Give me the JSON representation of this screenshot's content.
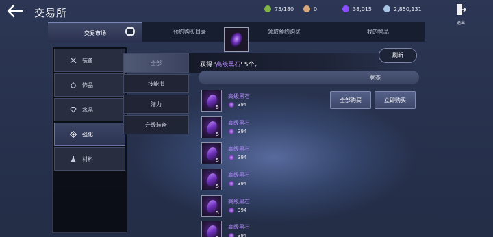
{
  "header": {
    "title": "交易所",
    "resources": [
      {
        "value": "75/180",
        "color": "#7fb344",
        "icon": "bag-icon"
      },
      {
        "value": "0",
        "color": "#d9a87a",
        "icon": "coin-icon"
      },
      {
        "value": "38,015",
        "color": "#8a4cff",
        "icon": "black-stone-currency-icon"
      },
      {
        "value": "2,850,131",
        "color": "#aac4e6",
        "icon": "silver-icon"
      }
    ],
    "exit_label": "退出"
  },
  "tabs": [
    {
      "label": "交易市场",
      "active": true
    },
    {
      "label": "预约购买目录",
      "active": false
    },
    {
      "label": "领取预约购买",
      "active": false
    },
    {
      "label": "我的物品",
      "active": false
    }
  ],
  "categories": [
    {
      "label": "装备",
      "icon": "crossed-swords-icon"
    },
    {
      "label": "饰品",
      "icon": "ring-icon"
    },
    {
      "label": "水晶",
      "icon": "crystal-icon"
    },
    {
      "label": "强化",
      "icon": "enhance-icon",
      "active": true
    },
    {
      "label": "材料",
      "icon": "flask-icon"
    }
  ],
  "subcategories": [
    {
      "label": "全部",
      "active": true
    },
    {
      "label": "技能书"
    },
    {
      "label": "潜力"
    },
    {
      "label": "升级装备"
    }
  ],
  "toast": {
    "prefix": "获得 '",
    "item": "高级黑石",
    "suffix": "' 5个。"
  },
  "refresh_label": "刷新",
  "status_label": "状态",
  "buttons": {
    "buy_all": "全部购买",
    "buy_now": "立即购买"
  },
  "items": [
    {
      "name": "高级黑石",
      "qty": "5",
      "price": "394"
    },
    {
      "name": "高级黑石",
      "qty": "5",
      "price": "394"
    },
    {
      "name": "高级黑石",
      "qty": "5",
      "price": "394"
    },
    {
      "name": "高级黑石",
      "qty": "5",
      "price": "394"
    },
    {
      "name": "高级黑石",
      "qty": "5",
      "price": "394"
    },
    {
      "name": "高级黑石",
      "qty": "5",
      "price": "394"
    }
  ]
}
